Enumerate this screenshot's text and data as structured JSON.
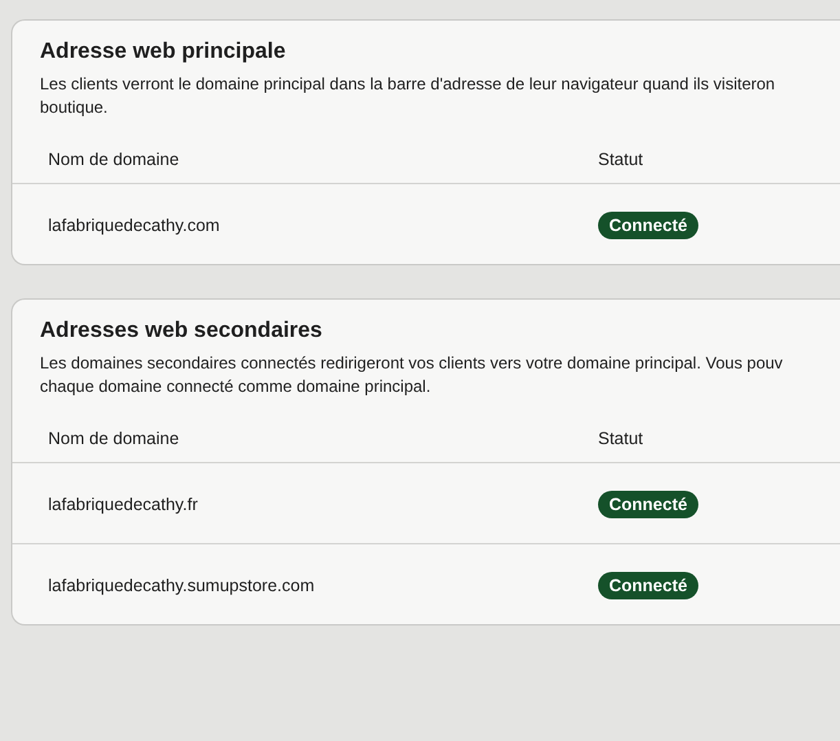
{
  "sections": [
    {
      "title": "Adresse web principale",
      "description_lines": [
        "Les clients verront le domaine principal dans la barre d'adresse de leur navigateur quand ils visiteron",
        "boutique."
      ],
      "columns": [
        "Nom de domaine",
        "Statut"
      ],
      "rows": [
        {
          "domain": "lafabriquedecathy.com",
          "status": "Connecté",
          "connected": true
        }
      ]
    },
    {
      "title": "Adresses web secondaires",
      "description_lines": [
        "Les domaines secondaires connectés redirigeront vos clients vers votre domaine principal. Vous pouv",
        "chaque domaine connecté comme domaine principal."
      ],
      "columns": [
        "Nom de domaine",
        "Statut"
      ],
      "rows": [
        {
          "domain": "lafabriquedecathy.fr",
          "status": "Connecté",
          "connected": true
        },
        {
          "domain": "lafabriquedecathy.sumupstore.com",
          "status": "Connecté",
          "connected": true
        }
      ]
    }
  ]
}
